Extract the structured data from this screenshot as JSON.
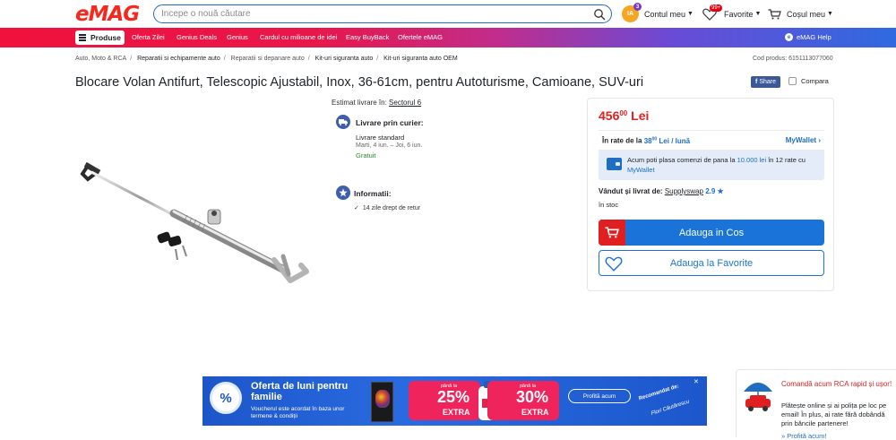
{
  "header": {
    "logo": "eMAG",
    "search_placeholder": "Începe o nouă căutare",
    "account": {
      "avatar_initials": "IA",
      "avatar_badge": "3",
      "label": "Contul meu"
    },
    "favorites": {
      "label": "Favorite",
      "badge": "99+"
    },
    "cart": {
      "label": "Coșul meu"
    }
  },
  "nav": {
    "products": "Produse",
    "links": [
      "Oferta Zilei",
      "Genius Deals",
      "Genius",
      "Cardul cu milioane de idei",
      "Easy BuyBack",
      "Ofertele eMAG"
    ],
    "help": "eMAG Help"
  },
  "breadcrumb": [
    "Auto, Moto & RCA",
    "Reparatii si echipamente auto",
    "Reparatii si depanare auto",
    "Kit-uri siguranta auto",
    "Kit-uri siguranta auto OEM"
  ],
  "product_code": "Cod produs: 6151113077060",
  "product": {
    "title": "Blocare Volan Antifurt, Telescopic Ajustabil, Inox, 36-61cm, pentru Autoturisme, Camioane, SUV-uri",
    "share": "Share",
    "compare": "Compara"
  },
  "delivery": {
    "estimate_label": "Estimat livrare în:",
    "estimate_location": "Sectorul 6",
    "courier_title": "Livrare prin curier:",
    "standard": "Livrare standard",
    "dates": "Marti, 4 iun. – Joi, 6 iun.",
    "cost": "Gratuit"
  },
  "info": {
    "title": "Informatii:",
    "return": "14 zile drept de retur"
  },
  "buybox": {
    "price_int": "456",
    "price_dec": "00",
    "currency": "Lei",
    "rate_prefix": "În rate de la",
    "rate_int": "38",
    "rate_dec": "00",
    "rate_suffix": "Lei / lună",
    "rate_link": "MyWallet",
    "mw_text_1": "Acum poti plasa comenzi de pana la",
    "mw_amount": "10.000 lei",
    "mw_text_2": "în 12 rate cu",
    "mw_link": "MyWallet",
    "seller_label": "Vândut și livrat de:",
    "seller_name": "Supplyswap",
    "seller_rating": "2.9 ★",
    "stock": "în stoc",
    "add_to_cart": "Adauga in Cos",
    "add_to_fav": "Adauga la Favorite"
  },
  "banner": {
    "title": "Oferta de luni pentru familie",
    "subtitle": "Voucherul este acordat în baza unor termene & condiții",
    "discount1_pre": "până la",
    "discount1": "25%",
    "discount1_suffix": "EXTRA",
    "discount2_pre": "până la",
    "discount2": "30%",
    "discount2_suffix": "EXTRA",
    "cta": "Profită acum",
    "rec_label": "Recomandat de:",
    "rec_name": "Florí Căutărescu",
    "close": "✕"
  },
  "rca": {
    "title": "Comandă acum RCA rapid și ușor!",
    "body": "Plătește online și ai polița pe loc pe email! În plus, ai rate fără dobândă prin băncile partenere!",
    "link": "» Profită acum!"
  },
  "colors": {
    "brand_red": "#f7291d",
    "price_red": "#e02020",
    "primary_blue": "#1a73d9",
    "success_green": "#2c8a2c"
  }
}
